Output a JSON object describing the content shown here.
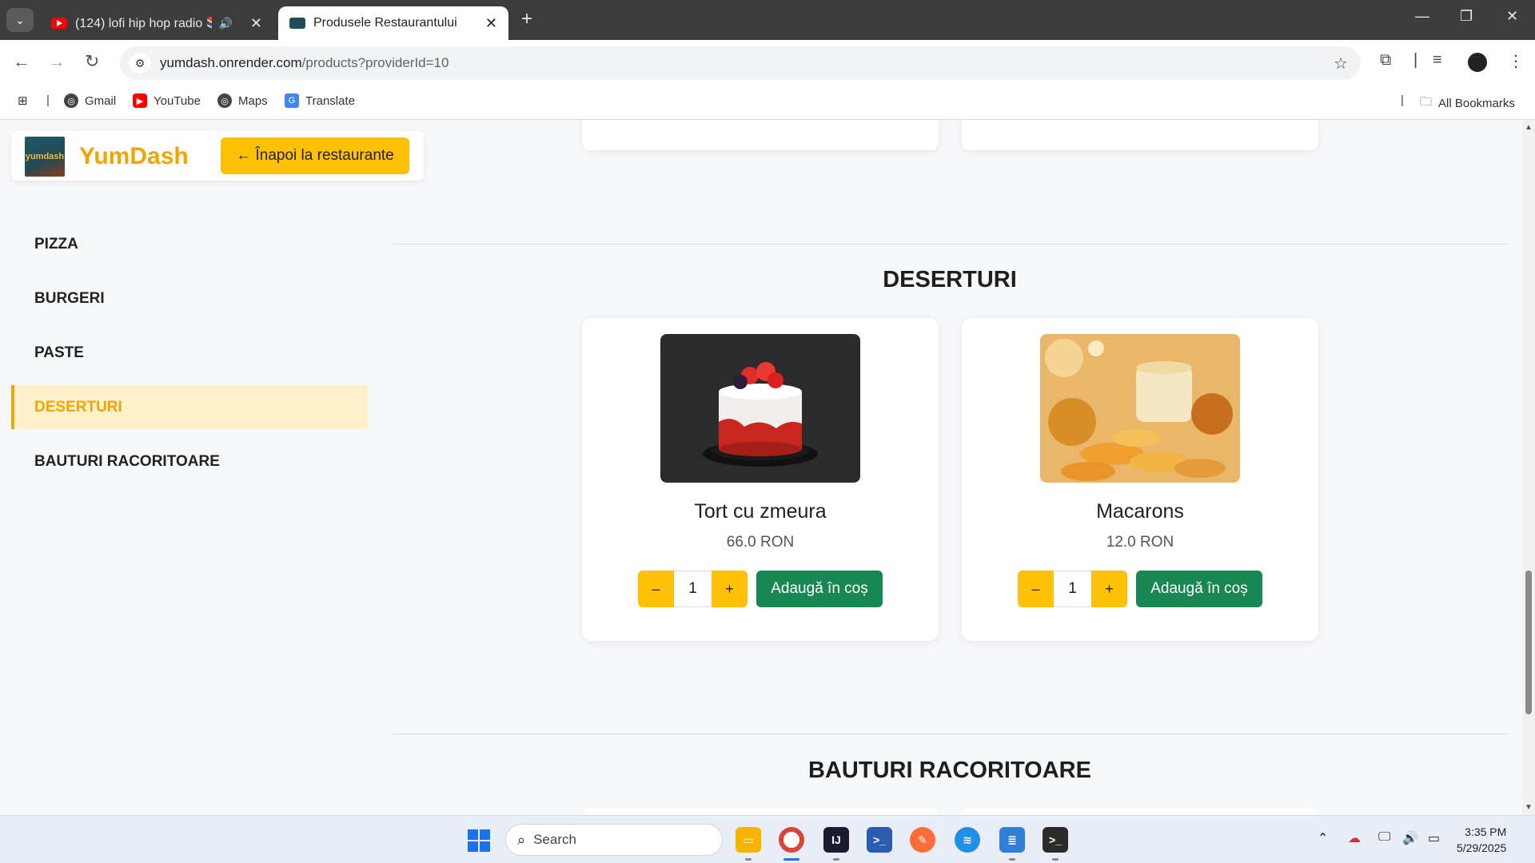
{
  "browser": {
    "tabs": [
      {
        "title": "(124) lofi hip hop radio 📚",
        "icon": "youtube-icon",
        "active": false
      },
      {
        "title": "Produsele Restaurantului",
        "icon": "yumdash-favicon",
        "active": true
      }
    ],
    "url_host": "yumdash.onrender.com",
    "url_path": "/products?providerId=10",
    "bookmarks": [
      {
        "label": "Gmail",
        "icon": "globe-icon"
      },
      {
        "label": "YouTube",
        "icon": "youtube-icon"
      },
      {
        "label": "Maps",
        "icon": "globe-icon"
      },
      {
        "label": "Translate",
        "icon": "translate-icon"
      }
    ],
    "all_bookmarks": "All Bookmarks"
  },
  "header": {
    "logo_text": "yumdash",
    "brand": "YumDash",
    "back_button": "← Înapoi la restaurante"
  },
  "sidebar": {
    "items": [
      {
        "label": "PIZZA",
        "active": false
      },
      {
        "label": "BURGERI",
        "active": false
      },
      {
        "label": "PASTE",
        "active": false
      },
      {
        "label": "DESERTURI",
        "active": true
      },
      {
        "label": "BAUTURI RACORITOARE",
        "active": false
      }
    ]
  },
  "sections": {
    "desserts": {
      "title": "DESERTURI",
      "products": [
        {
          "name": "Tort cu zmeura",
          "price": "66.0 RON",
          "quantity": "1",
          "minus": "–",
          "plus": "+",
          "add_label": "Adaugă în coș"
        },
        {
          "name": "Macarons",
          "price": "12.0 RON",
          "quantity": "1",
          "minus": "–",
          "plus": "+",
          "add_label": "Adaugă în coș"
        }
      ]
    },
    "drinks": {
      "title": "BAUTURI RACORITOARE"
    }
  },
  "taskbar": {
    "search_placeholder": "Search",
    "time": "3:35 PM",
    "date": "5/29/2025"
  },
  "colors": {
    "accent": "#f0a500",
    "button_yellow": "#ffc107",
    "add_green": "#198754",
    "active_bg": "#fff1cc"
  }
}
